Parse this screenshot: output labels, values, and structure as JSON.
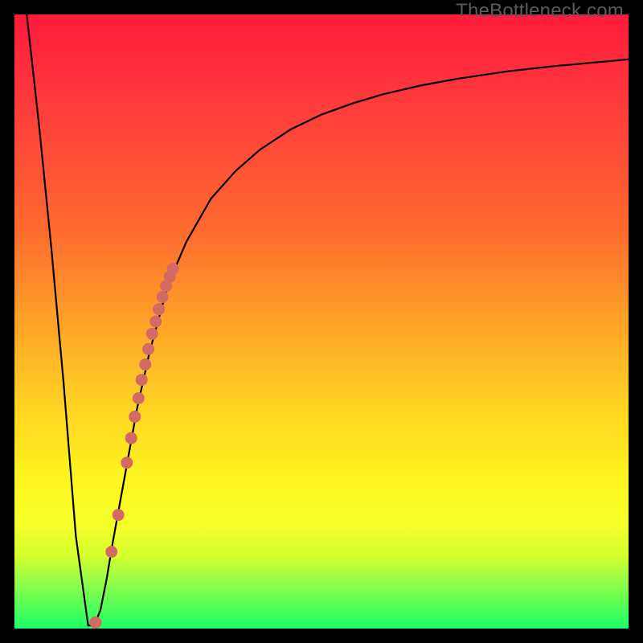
{
  "watermark": "TheBottleneck.com",
  "colors": {
    "black": "#000000",
    "curve": "#000000",
    "dot_fill": "#d36a64",
    "dot_stroke": "#8c3a36"
  },
  "chart_data": {
    "type": "line",
    "title": "",
    "xlabel": "",
    "ylabel": "",
    "xlim": [
      0,
      100
    ],
    "ylim": [
      0,
      100
    ],
    "series": [
      {
        "name": "black-curve-left",
        "x": [
          2,
          4,
          6,
          8,
          10,
          12
        ],
        "values": [
          100,
          82,
          62,
          40,
          15,
          0.5
        ]
      },
      {
        "name": "black-curve-right",
        "x": [
          12,
          13,
          14,
          15,
          16,
          18,
          20,
          22,
          25,
          28,
          32,
          36,
          40,
          45,
          50,
          55,
          60,
          66,
          72,
          80,
          88,
          98,
          100
        ],
        "values": [
          0.5,
          0.5,
          3,
          8,
          14,
          25,
          36,
          45,
          56,
          63,
          70,
          74.5,
          78,
          81.3,
          83.7,
          85.5,
          87,
          88.4,
          89.5,
          90.7,
          91.6,
          92.5,
          92.7
        ]
      }
    ],
    "dots": {
      "x": [
        13.2,
        15.8,
        16.9,
        18.3,
        19.0,
        19.6,
        20.2,
        20.7,
        21.3,
        21.8,
        22.4,
        23.0,
        23.5,
        24.1,
        24.7,
        25.3,
        25.8
      ],
      "values": [
        1.0,
        12.5,
        18.5,
        27.0,
        31.0,
        34.5,
        37.5,
        40.5,
        43.0,
        45.5,
        48.0,
        50.0,
        52.0,
        54.0,
        55.8,
        57.3,
        58.6
      ]
    }
  }
}
